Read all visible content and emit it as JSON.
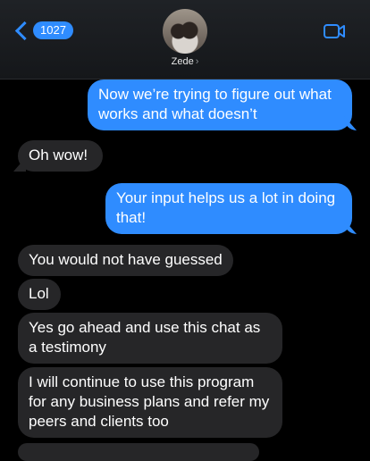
{
  "header": {
    "back_count": "1027",
    "contact_name": "Zede",
    "contact_chevron": "›"
  },
  "icons": {
    "back": "chevron-left-icon",
    "video": "video-camera-icon",
    "avatar": "contact-avatar"
  },
  "colors": {
    "accent": "#2f8cff",
    "incoming": "#262628",
    "background": "#000000"
  },
  "messages": [
    {
      "direction": "outgoing",
      "text": "Now we’re trying to figure out what works and what doesn’t"
    },
    {
      "direction": "incoming",
      "text": "Oh wow!"
    },
    {
      "direction": "outgoing",
      "text": "Your input helps us a lot in doing that!"
    },
    {
      "direction": "incoming",
      "text": "You would not have guessed"
    },
    {
      "direction": "incoming",
      "text": "Lol"
    },
    {
      "direction": "incoming",
      "text": "Yes go ahead and use this chat as a testimony"
    },
    {
      "direction": "incoming",
      "text": "I will continue to use this program for any business plans and refer my peers and clients too"
    }
  ]
}
